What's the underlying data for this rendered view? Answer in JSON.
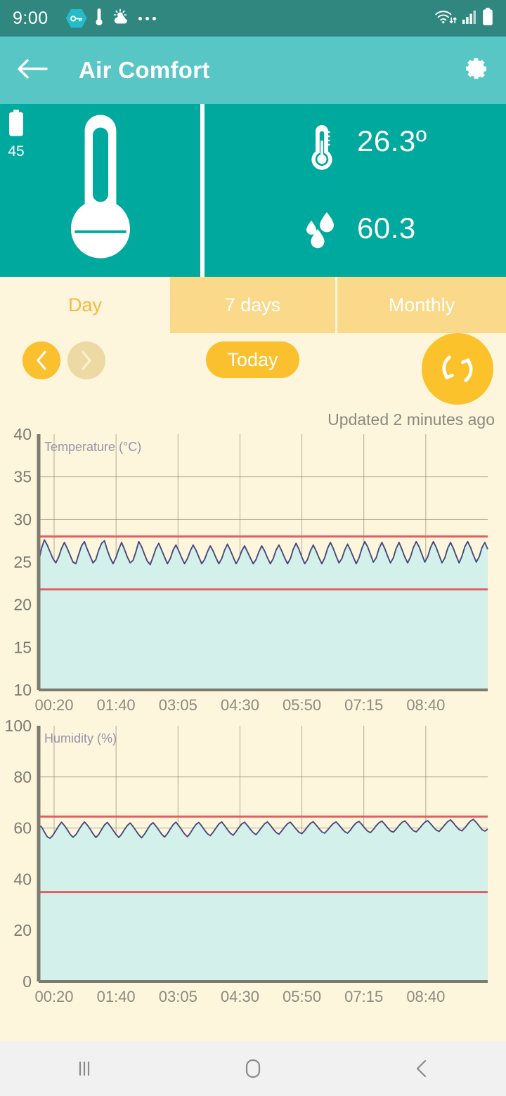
{
  "status_bar": {
    "time": "9:00",
    "icons": [
      "vpn-key-icon",
      "thermometer-icon",
      "weather-partly-cloudy-icon",
      "overflow-dots-icon"
    ],
    "right_icons": [
      "wifi-icon",
      "cellular-signal-icon",
      "battery-icon"
    ]
  },
  "app_bar": {
    "back_label": "",
    "title": "Air Comfort",
    "settings_label": ""
  },
  "sensor": {
    "battery_level": "45",
    "temperature_value": "26.3º",
    "temperature_unit": "C",
    "humidity_value": "60.3",
    "humidity_unit": "%"
  },
  "tabs": [
    {
      "label": "Day",
      "active": true
    },
    {
      "label": "7 days",
      "active": false
    },
    {
      "label": "Monthly",
      "active": false
    }
  ],
  "controls": {
    "prev_label": "‹",
    "next_label": "›",
    "today_label": "Today",
    "refresh_label": "",
    "updated_text": "Updated 2 minutes ago"
  },
  "android_nav": {
    "recents": "|||",
    "home": "▢",
    "back": "‹"
  },
  "colors": {
    "status_bar": "#2f8780",
    "app_bar": "#58c6c4",
    "sensor_panel": "#00a99d",
    "page_bg": "#fdf6dc",
    "tab_inactive": "#fbd98a",
    "accent_amber": "#fbc02d",
    "chart_line": "#4a4a7a",
    "chart_fill": "#d3f0ea",
    "threshold_line": "#e06060",
    "grid_line": "#8a8378"
  },
  "chart_data": [
    {
      "type": "area",
      "title": "Temperature (°C)",
      "xlabel": "",
      "ylabel": "Temperature (°C)",
      "ylim": [
        10,
        40
      ],
      "yticks": [
        10,
        15,
        20,
        25,
        30,
        35,
        40
      ],
      "xticks": [
        "00:20",
        "01:40",
        "03:05",
        "04:30",
        "05:50",
        "07:15",
        "08:40"
      ],
      "grid": true,
      "thresholds": [
        {
          "name": "upper",
          "value": 28.0,
          "color": "#e06060"
        },
        {
          "name": "lower",
          "value": 21.8,
          "color": "#e06060"
        }
      ],
      "fill_base": 25.0,
      "values": [
        25.0,
        26.6,
        27.6,
        27.0,
        26.2,
        25.4,
        24.9,
        25.6,
        26.6,
        27.3,
        26.6,
        25.8,
        25.0,
        24.8,
        25.9,
        26.9,
        27.4,
        26.5,
        25.7,
        24.9,
        25.3,
        26.4,
        27.2,
        27.5,
        26.4,
        25.5,
        24.8,
        25.5,
        26.5,
        27.3,
        26.5,
        25.6,
        24.9,
        25.2,
        26.2,
        27.4,
        26.8,
        25.9,
        25.1,
        24.7,
        25.6,
        26.6,
        27.2,
        26.4,
        25.6,
        24.8,
        25.4,
        26.4,
        27.0,
        26.3,
        25.5,
        24.8,
        25.4,
        26.3,
        27.0,
        26.4,
        25.6,
        24.8,
        25.3,
        26.2,
        26.9,
        26.3,
        25.5,
        24.8,
        25.4,
        26.4,
        27.1,
        26.4,
        25.6,
        24.8,
        25.4,
        26.3,
        26.9,
        26.2,
        25.5,
        24.8,
        25.3,
        26.2,
        26.9,
        26.3,
        25.5,
        24.8,
        25.4,
        26.4,
        27.0,
        26.3,
        25.5,
        24.8,
        25.4,
        26.5,
        27.2,
        26.5,
        25.6,
        24.8,
        25.3,
        26.3,
        27.0,
        26.3,
        25.5,
        24.8,
        25.5,
        26.6,
        27.3,
        26.6,
        25.7,
        24.9,
        25.4,
        26.4,
        27.1,
        26.4,
        25.6,
        24.8,
        25.5,
        26.6,
        27.4,
        26.8,
        25.9,
        25.0,
        25.5,
        26.6,
        27.3,
        26.6,
        25.7,
        24.9,
        25.5,
        26.6,
        27.3,
        26.5,
        25.6,
        24.9,
        25.6,
        26.7,
        27.4,
        26.8,
        25.9,
        25.0,
        25.6,
        26.7,
        27.4,
        26.7,
        25.8,
        24.9,
        25.5,
        26.6,
        27.3,
        26.6,
        25.7,
        24.9,
        25.7,
        26.8,
        27.4,
        26.7,
        25.8,
        25.0,
        25.6,
        26.7,
        27.3,
        26.5
      ]
    },
    {
      "type": "area",
      "title": "Humidity (%)",
      "xlabel": "",
      "ylabel": "Humidity (%)",
      "ylim": [
        0,
        100
      ],
      "yticks": [
        0,
        20,
        40,
        60,
        80,
        100
      ],
      "xticks": [
        "00:20",
        "01:40",
        "03:05",
        "04:30",
        "05:50",
        "07:15",
        "08:40"
      ],
      "grid": true,
      "thresholds": [
        {
          "name": "upper",
          "value": 64.5,
          "color": "#e06060"
        },
        {
          "name": "lower",
          "value": 35.0,
          "color": "#e06060"
        }
      ],
      "fill_base": 61.0,
      "values": [
        61.0,
        60.5,
        58.5,
        56.6,
        56.0,
        57.2,
        59.0,
        60.8,
        62.3,
        61.0,
        59.4,
        57.6,
        56.4,
        57.4,
        59.2,
        61.0,
        62.4,
        61.2,
        59.6,
        57.8,
        56.3,
        57.5,
        59.4,
        61.2,
        62.2,
        60.8,
        59.2,
        57.6,
        56.3,
        57.6,
        59.4,
        61.0,
        62.0,
        60.6,
        59.0,
        57.4,
        56.2,
        57.6,
        59.4,
        61.2,
        62.1,
        60.8,
        59.2,
        57.6,
        56.5,
        57.8,
        59.6,
        61.3,
        62.3,
        60.9,
        59.3,
        57.7,
        56.6,
        58.0,
        59.8,
        61.4,
        62.2,
        60.8,
        59.2,
        57.8,
        57.0,
        58.4,
        60.0,
        61.6,
        62.4,
        61.0,
        59.4,
        58.0,
        57.2,
        58.6,
        60.2,
        61.6,
        62.3,
        61.0,
        59.5,
        58.2,
        57.4,
        58.8,
        60.3,
        61.7,
        62.4,
        61.1,
        59.6,
        58.3,
        57.6,
        58.9,
        60.4,
        61.7,
        62.3,
        61.0,
        59.6,
        58.4,
        57.8,
        59.0,
        60.5,
        61.8,
        62.5,
        61.2,
        59.8,
        58.5,
        58.0,
        59.2,
        60.6,
        61.8,
        62.4,
        61.2,
        59.8,
        58.6,
        58.0,
        59.2,
        60.8,
        62.0,
        62.6,
        61.4,
        60.0,
        58.8,
        58.2,
        59.4,
        60.9,
        62.1,
        62.7,
        61.5,
        60.1,
        58.9,
        58.4,
        59.6,
        61.0,
        62.2,
        62.8,
        61.6,
        60.2,
        59.0,
        58.5,
        59.7,
        61.1,
        62.3,
        62.9,
        61.7,
        60.4,
        59.2,
        58.7,
        59.9,
        61.3,
        62.5,
        63.2,
        62.0,
        60.6,
        59.4,
        58.9,
        60.1,
        61.5,
        62.8,
        63.4,
        62.2,
        60.8,
        59.4,
        58.8,
        59.6
      ]
    }
  ]
}
